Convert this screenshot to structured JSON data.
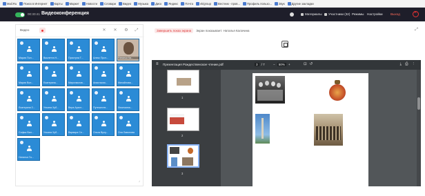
{
  "bookmarks": [
    {
      "label": "Mail.Ru"
    },
    {
      "label": "Поиск в Интернет"
    },
    {
      "label": "Карты"
    },
    {
      "label": "Маркет"
    },
    {
      "label": "Новости"
    },
    {
      "label": "Словари"
    },
    {
      "label": "Видео"
    },
    {
      "label": "Музыка"
    },
    {
      "label": "Диск"
    },
    {
      "label": "Яндекс"
    },
    {
      "label": "Почта"
    },
    {
      "label": "vk/group"
    },
    {
      "label": "Вестник - пров..."
    },
    {
      "label": "Профиль пользо..."
    },
    {
      "label": "Звук"
    },
    {
      "label": "Другие закладки"
    }
  ],
  "header": {
    "timer": "00:30:41",
    "title": "Видеоконференция",
    "materials": "Материалы",
    "participants": "Участники (32)",
    "modes": "Режимы",
    "settings": "Настройки",
    "exit": "Выход"
  },
  "left_panel": {
    "video_tab": "Видео",
    "participants": [
      {
        "name": "Мария Пол..."
      },
      {
        "name": "Виолетта Н..."
      },
      {
        "name": "Приступа Т..."
      },
      {
        "name": "Алекс Прот..."
      },
      {
        "name": "Наталья Ка...",
        "photo": true
      },
      {
        "name": "Мария Вол..."
      },
      {
        "name": "Екатерина..."
      },
      {
        "name": "Мирохвалов..."
      },
      {
        "name": "Анастасия..."
      },
      {
        "name": "Михайлова..."
      },
      {
        "name": "Екатерина З..."
      },
      {
        "name": "Ульяна Хуб..."
      },
      {
        "name": "Вера Архит..."
      },
      {
        "name": "Путешеств..."
      },
      {
        "name": "Лисичкина..."
      },
      {
        "name": "Софья Вал..."
      },
      {
        "name": "Ульяна Хуб..."
      },
      {
        "name": "Варвара Се..."
      },
      {
        "name": "Ольга Вулу..."
      },
      {
        "name": "Оля Лавонова"
      },
      {
        "name": "Наталья Га..."
      }
    ]
  },
  "share": {
    "stop_label": "Завершить показ экрана",
    "info": "Экран показывает: Наталья Калачина"
  },
  "pdf": {
    "title": "Презентация Рождественское чтение.pdf",
    "current_page": "3",
    "total_pages": "/ 7",
    "zoom": "50%",
    "thumbnails": [
      {
        "number": "1"
      },
      {
        "number": "2"
      },
      {
        "number": "3"
      }
    ]
  }
}
